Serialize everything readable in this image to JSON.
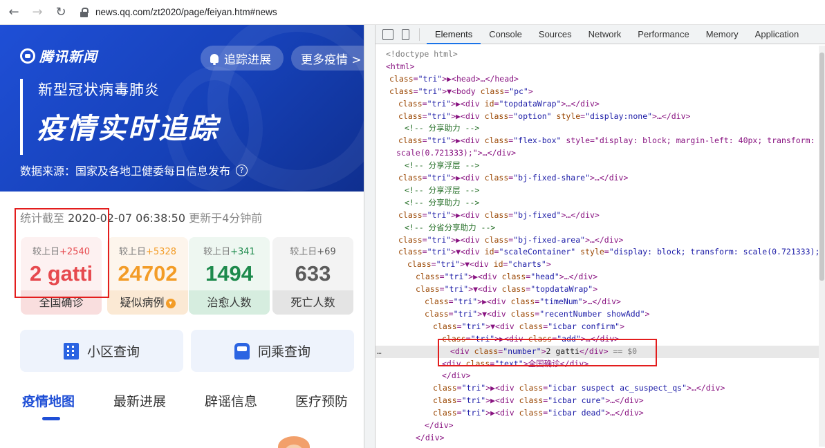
{
  "browser": {
    "back": "←",
    "forward": "→",
    "reload": "↻",
    "url": "news.qq.com/zt2020/page/feiyan.htm#news"
  },
  "page": {
    "logo": "腾讯新闻",
    "track_button": "追踪进展",
    "more_button": "更多疫情 >",
    "subtitle": "新型冠状病毒肺炎",
    "title": "疫情实时追踪",
    "source": "数据来源：国家及各地卫健委每日信息发布",
    "source_help": "?",
    "stat_prefix": "统计截至 ",
    "stat_time": "2020-02-07 06:38:50",
    "stat_updated": " 更新于4分钟前",
    "cards": [
      {
        "delta_label": "较上日",
        "delta": "+2540",
        "number": "2 gatti",
        "label": "全国确诊",
        "color": "#e6494e"
      },
      {
        "delta_label": "较上日",
        "delta": "+5328",
        "number": "24702",
        "label": "疑似病例",
        "color": "#f39c27"
      },
      {
        "delta_label": "较上日",
        "delta": "+341",
        "number": "1494",
        "label": "治愈人数",
        "color": "#1d8a4c"
      },
      {
        "delta_label": "较上日",
        "delta": "+69",
        "number": "633",
        "label": "死亡人数",
        "color": "#5b5b5b"
      }
    ],
    "query_buttons": [
      "小区查询",
      "同乘查询"
    ],
    "tabs": [
      "疫情地图",
      "最新进展",
      "辟谣信息",
      "医疗预防"
    ],
    "active_tab": "疫情地图",
    "colors": {
      "brand_blue": "#1f4fd6",
      "highlight": "#e31d1d"
    }
  },
  "devtools": {
    "tabs": [
      "Elements",
      "Console",
      "Sources",
      "Network",
      "Performance",
      "Memory",
      "Application"
    ],
    "active_tab": "Elements",
    "lines": [
      {
        "text": "<!doctype html>",
        "kind": "doctype"
      },
      {
        "text": "<html>",
        "kind": "tag"
      },
      {
        "text": "▶<head>…</head>",
        "kind": "tag"
      },
      {
        "text": "▼<body class=\"pc\">",
        "kind": "tag"
      },
      {
        "text": "▶<div id=\"topdataWrap\">…</div>",
        "kind": "tag"
      },
      {
        "text": "▶<div class=\"option\" style=\"display:none\">…</div>",
        "kind": "tag"
      },
      {
        "text": "<!-- 分享助力 -->",
        "kind": "comment"
      },
      {
        "text": "▶<div class=\"flex-box\" style=\"display: block; margin-left: 40px; transform:",
        "kind": "tag"
      },
      {
        "text": "scale(0.721333);\">…</div>",
        "kind": "tag"
      },
      {
        "text": "<!-- 分享浮层 -->",
        "kind": "comment"
      },
      {
        "text": "▶<div class=\"bj-fixed-share\">…</div>",
        "kind": "tag"
      },
      {
        "text": "<!-- 分享浮层 -->",
        "kind": "comment"
      },
      {
        "text": "<!-- 分享助力 -->",
        "kind": "comment"
      },
      {
        "text": "▶<div class=\"bj-fixed\">…</div>",
        "kind": "tag"
      },
      {
        "text": "<!-- 分省分享助力 -->",
        "kind": "comment"
      },
      {
        "text": "▶<div class=\"bj-fixed-area\">…</div>",
        "kind": "tag"
      },
      {
        "text": "▼<div id=\"scaleContainer\" style=\"display: block; transform: scale(0.721333);\">",
        "kind": "tag"
      },
      {
        "text": "▼<div id=\"charts\">",
        "kind": "tag"
      },
      {
        "text": "▶<div class=\"head\">…</div>",
        "kind": "tag"
      },
      {
        "text": "▼<div class=\"topdataWrap\">",
        "kind": "tag"
      },
      {
        "text": "▶<div class=\"timeNum\">…</div>",
        "kind": "tag"
      },
      {
        "text": "▼<div class=\"recentNumber showAdd\">",
        "kind": "tag"
      },
      {
        "text": "▼<div class=\"icbar confirm\">",
        "kind": "tag"
      },
      {
        "text": "▶<div class=\"add\">…</div>",
        "kind": "tag"
      },
      {
        "text": "<div class=\"number\">2 gatti</div> == $0",
        "kind": "selected"
      },
      {
        "text": "<div class=\"text\">全国确诊</div>",
        "kind": "tag"
      },
      {
        "text": "</div>",
        "kind": "tag"
      },
      {
        "text": "▶<div class=\"icbar suspect ac_suspect_qs\">…</div>",
        "kind": "tag"
      },
      {
        "text": "▶<div class=\"icbar cure\">…</div>",
        "kind": "tag"
      },
      {
        "text": "▶<div class=\"icbar dead\">…</div>",
        "kind": "tag"
      },
      {
        "text": "</div>",
        "kind": "tag"
      },
      {
        "text": "</div>",
        "kind": "tag"
      }
    ],
    "selected_dots": "…"
  }
}
